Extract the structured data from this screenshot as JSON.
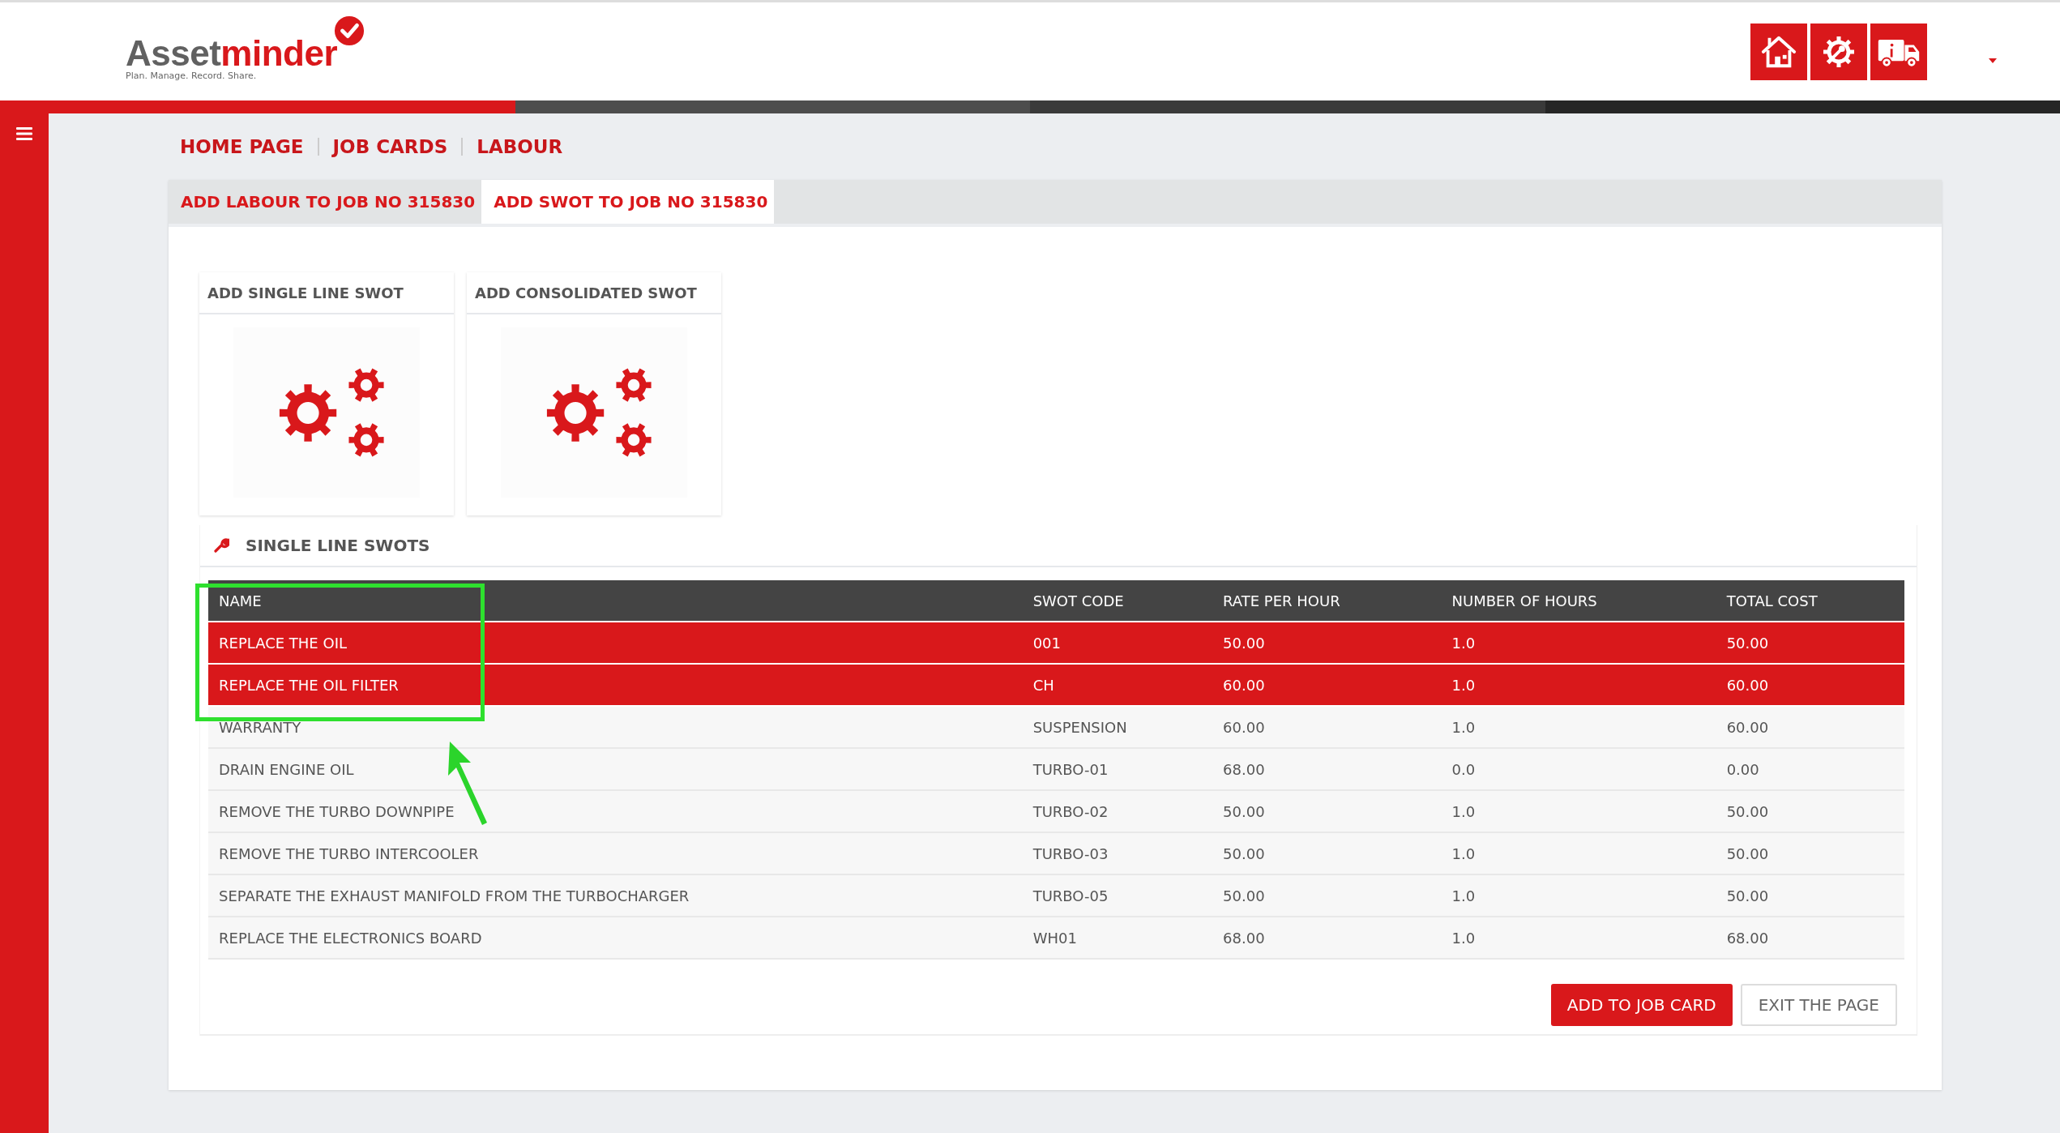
{
  "logo": {
    "word_start": "Asset",
    "word_end": "minder",
    "tagline": "Plan. Manage. Record. Share."
  },
  "breadcrumb": [
    "HOME PAGE",
    "JOB CARDS",
    "LABOUR"
  ],
  "tabs": [
    {
      "label": "ADD LABOUR TO JOB NO 315830",
      "selected": false
    },
    {
      "label": "ADD SWOT TO JOB NO 315830",
      "selected": true
    }
  ],
  "cards": [
    {
      "title": "ADD SINGLE LINE SWOT"
    },
    {
      "title": "ADD CONSOLIDATED SWOT"
    }
  ],
  "section": {
    "title": "SINGLE LINE SWOTS"
  },
  "table": {
    "columns": [
      "NAME",
      "SWOT CODE",
      "RATE PER HOUR",
      "NUMBER OF HOURS",
      "TOTAL COST"
    ],
    "rows": [
      {
        "cells": [
          "REPLACE THE OIL",
          "001",
          "50.00",
          "1.0",
          "50.00"
        ],
        "selected": true
      },
      {
        "cells": [
          "REPLACE THE OIL FILTER",
          "CH",
          "60.00",
          "1.0",
          "60.00"
        ],
        "selected": true
      },
      {
        "cells": [
          "WARRANTY",
          "SUSPENSION",
          "60.00",
          "1.0",
          "60.00"
        ],
        "selected": false
      },
      {
        "cells": [
          "DRAIN ENGINE OIL",
          "TURBO-01",
          "68.00",
          "0.0",
          "0.00"
        ],
        "selected": false
      },
      {
        "cells": [
          "REMOVE THE TURBO DOWNPIPE",
          "TURBO-02",
          "50.00",
          "1.0",
          "50.00"
        ],
        "selected": false
      },
      {
        "cells": [
          "REMOVE THE TURBO INTERCOOLER",
          "TURBO-03",
          "50.00",
          "1.0",
          "50.00"
        ],
        "selected": false
      },
      {
        "cells": [
          "SEPARATE THE EXHAUST MANIFOLD FROM THE TURBOCHARGER",
          "TURBO-05",
          "50.00",
          "1.0",
          "50.00"
        ],
        "selected": false
      },
      {
        "cells": [
          "REPLACE THE ELECTRONICS BOARD",
          "WH01",
          "68.00",
          "1.0",
          "68.00"
        ],
        "selected": false
      }
    ]
  },
  "buttons": [
    {
      "label": "ADD TO JOB CARD",
      "kind": "primary"
    },
    {
      "label": "EXIT THE PAGE",
      "kind": "secondary"
    }
  ]
}
